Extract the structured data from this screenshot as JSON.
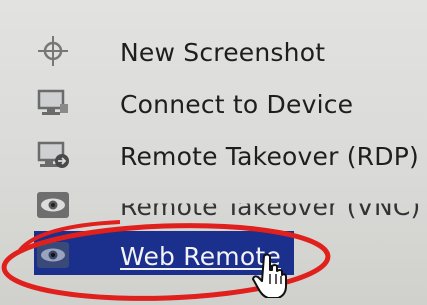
{
  "context_menu": {
    "items": [
      {
        "label": "New Screenshot",
        "icon": "crosshair-icon"
      },
      {
        "label": "Connect to Device",
        "icon": "monitor-icon"
      },
      {
        "label": "Remote Takeover (RDP)",
        "icon": "monitor-remote-icon"
      },
      {
        "label": "Remote Takeover (VNC)",
        "icon": "eye-icon"
      },
      {
        "label": "Web Remote",
        "icon": "eye-icon",
        "highlighted": true
      }
    ]
  },
  "annotation": {
    "type": "ellipse",
    "color": "#e0201c",
    "target": "Web Remote"
  },
  "colors": {
    "highlight_background": "#1b2f8c",
    "menu_background": "#dcdcda"
  }
}
